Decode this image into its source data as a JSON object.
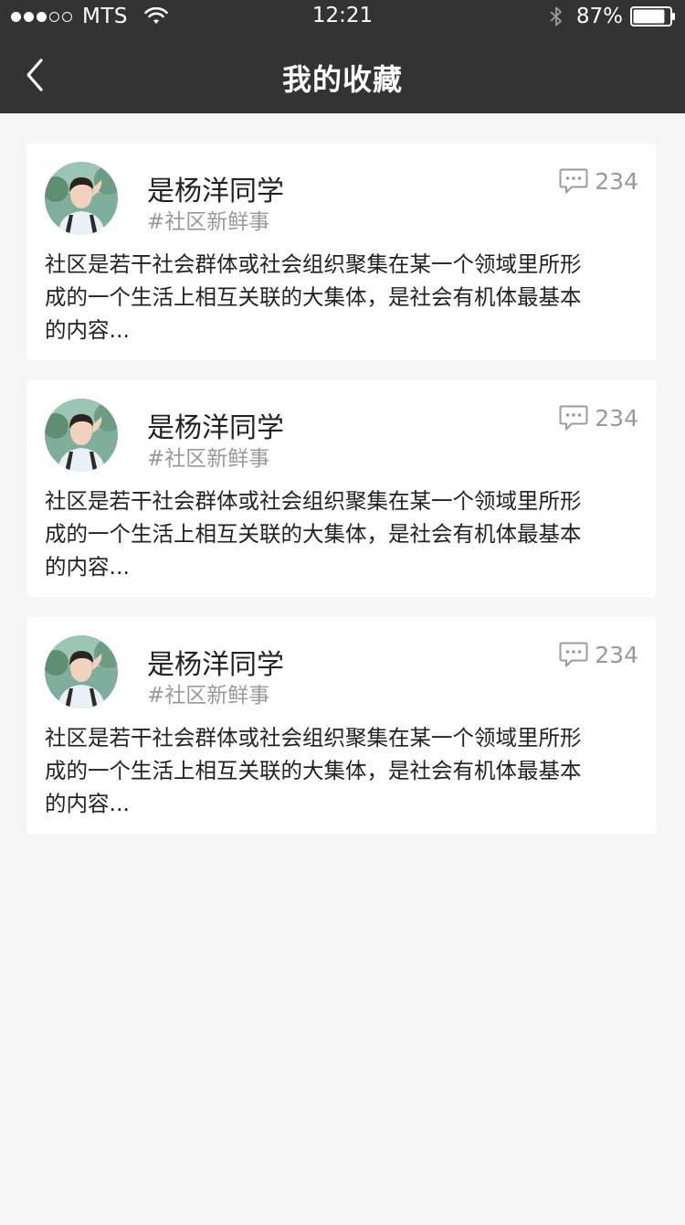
{
  "status_bar": {
    "carrier": "MTS",
    "signal_dots_full": 3,
    "signal_dots_total": 5,
    "time": "12:21",
    "battery_percent": "87%",
    "battery_level": 0.87
  },
  "nav": {
    "title": "我的收藏",
    "back_icon": "chevron-left-icon"
  },
  "colors": {
    "header_bg": "#333333",
    "page_bg": "#f6f6f6",
    "card_bg": "#ffffff",
    "muted_text": "#999999"
  },
  "cards": [
    {
      "username": "是杨洋同学",
      "tag": "#社区新鲜事",
      "comment_count": "234",
      "content_line1": "社区是若干社会群体或社会组织聚集在某一个领域里所形",
      "content_line2": "成的一个生活上相互关联的大集体，是社会有机体最基本",
      "content_line3": "的内容..."
    },
    {
      "username": "是杨洋同学",
      "tag": "#社区新鲜事",
      "comment_count": "234",
      "content_line1": "社区是若干社会群体或社会组织聚集在某一个领域里所形",
      "content_line2": "成的一个生活上相互关联的大集体，是社会有机体最基本",
      "content_line3": "的内容..."
    },
    {
      "username": "是杨洋同学",
      "tag": "#社区新鲜事",
      "comment_count": "234",
      "content_line1": "社区是若干社会群体或社会组织聚集在某一个领域里所形",
      "content_line2": "成的一个生活上相互关联的大集体，是社会有机体最基本",
      "content_line3": "的内容..."
    }
  ]
}
